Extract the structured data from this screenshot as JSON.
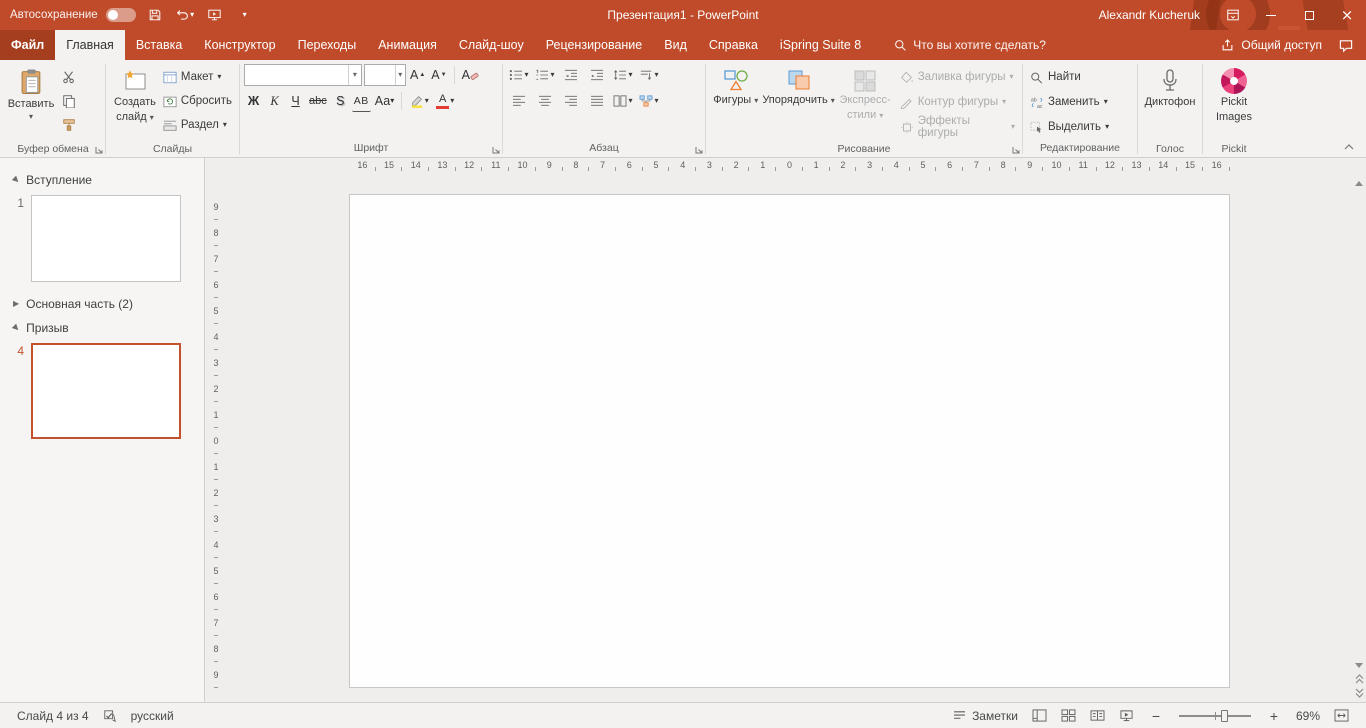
{
  "colors": {
    "accent": "#BF4B2B",
    "accent_dark": "#A53D1F",
    "selection": "#C4512D"
  },
  "titlebar": {
    "autosave": "Автосохранение",
    "title": "Презентация1  -  PowerPoint",
    "user": "Alexandr Kucheruk"
  },
  "tabs": {
    "file": "Файл",
    "home": "Главная",
    "insert": "Вставка",
    "design": "Конструктор",
    "transitions": "Переходы",
    "animations": "Анимация",
    "slideshow": "Слайд-шоу",
    "review": "Рецензирование",
    "view": "Вид",
    "help": "Справка",
    "ispring": "iSpring Suite 8",
    "search": "Что вы хотите сделать?",
    "share": "Общий доступ"
  },
  "ribbon": {
    "clipboard": {
      "label": "Буфер обмена",
      "paste": "Вставить"
    },
    "slides": {
      "label": "Слайды",
      "new_slide_line1": "Создать",
      "new_slide_line2": "слайд",
      "layout": "Макет",
      "reset": "Сбросить",
      "section": "Раздел"
    },
    "font": {
      "label": "Шрифт",
      "name_value": "",
      "size_value": "",
      "bold": "Ж",
      "italic": "К",
      "underline": "Ч",
      "strike": "abc",
      "shadow": "S",
      "spacing": "АВ",
      "case": "Аа",
      "color": "А",
      "grow": "А",
      "shrink": "А",
      "clear": "А"
    },
    "paragraph": {
      "label": "Абзац"
    },
    "drawing": {
      "label": "Рисование",
      "shapes": "Фигуры",
      "arrange": "Упорядочить",
      "styles_line1": "Экспресс-",
      "styles_line2": "стили",
      "fill": "Заливка фигуры",
      "outline": "Контур фигуры",
      "effects": "Эффекты фигуры"
    },
    "editing": {
      "label": "Редактирование",
      "find": "Найти",
      "replace": "Заменить",
      "select": "Выделить"
    },
    "voice": {
      "label": "Голос",
      "dictaphone": "Диктофон"
    },
    "pickit": {
      "label": "Pickit",
      "images_line1": "Pickit",
      "images_line2": "Images"
    }
  },
  "panel": {
    "section1": "Вступление",
    "section2": "Основная часть (2)",
    "section3": "Призыв",
    "slide1_num": "1",
    "slide4_num": "4"
  },
  "ruler": {
    "horizontal": [
      16,
      15,
      14,
      13,
      12,
      11,
      10,
      9,
      8,
      7,
      6,
      5,
      4,
      3,
      2,
      1,
      0,
      1,
      2,
      3,
      4,
      5,
      6,
      7,
      8,
      9,
      10,
      11,
      12,
      13,
      14,
      15,
      16
    ],
    "vertical": [
      9,
      8,
      7,
      6,
      5,
      4,
      3,
      2,
      1,
      0,
      1,
      2,
      3,
      4,
      5,
      6,
      7,
      8,
      9
    ]
  },
  "statusbar": {
    "counter": "Слайд 4 из 4",
    "language": "русский",
    "notes": "Заметки",
    "zoom": "69%"
  }
}
